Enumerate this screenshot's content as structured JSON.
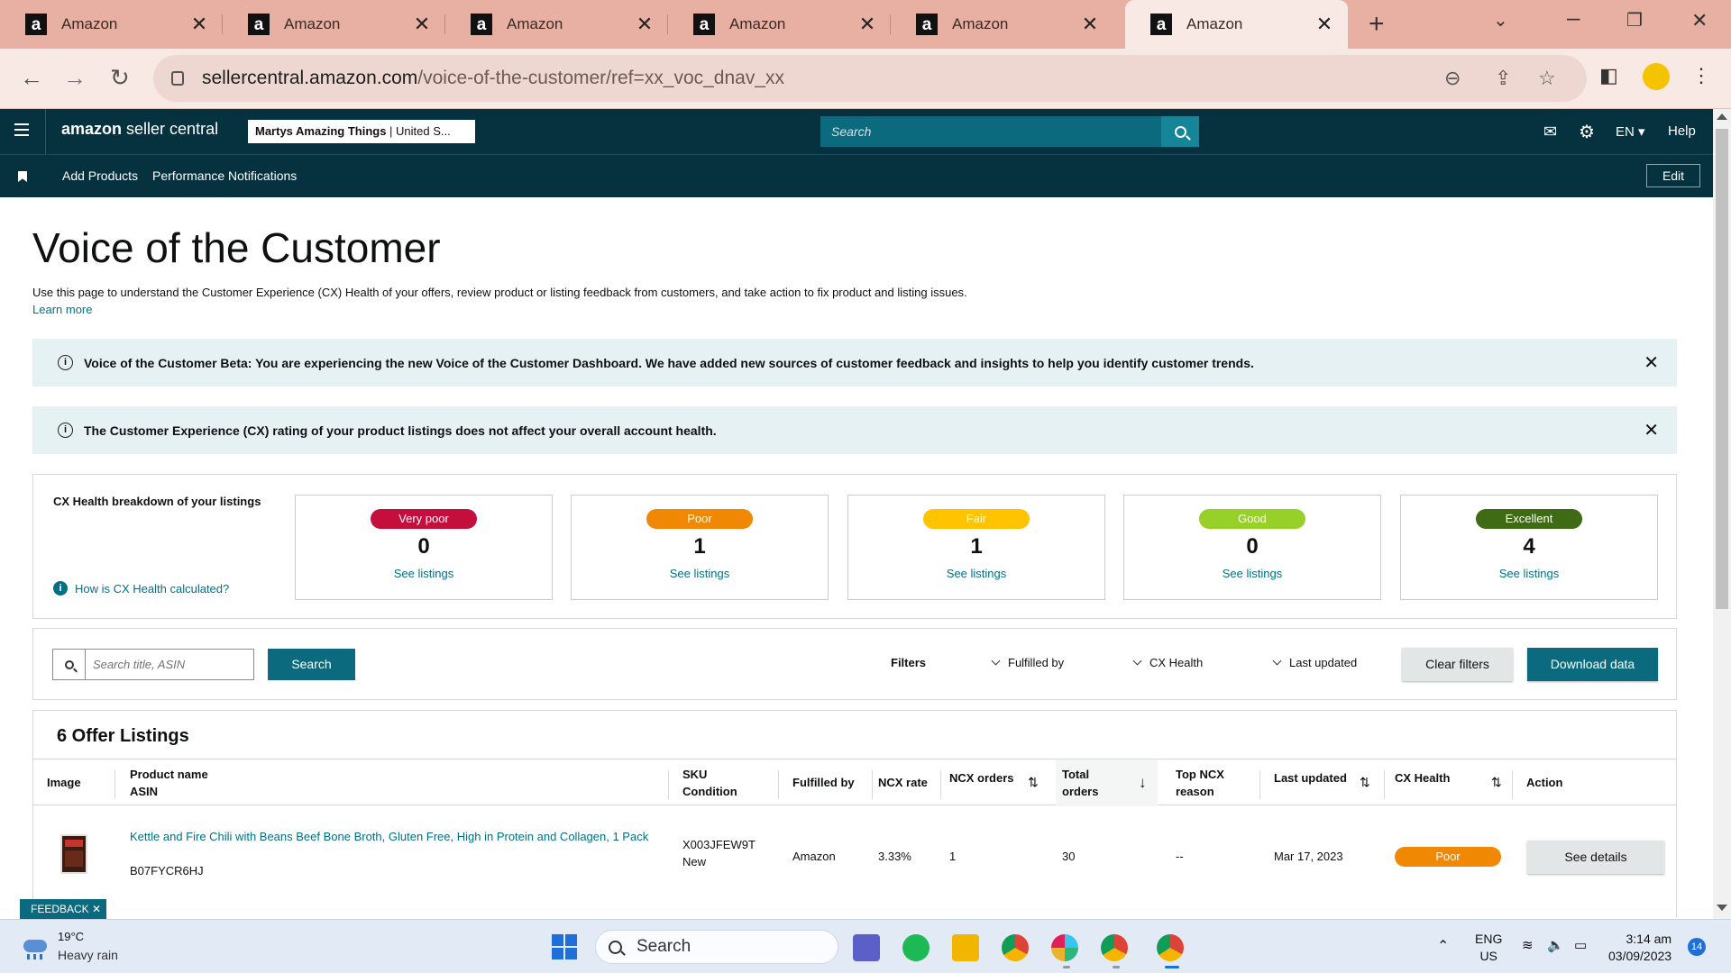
{
  "browser": {
    "tabs": [
      {
        "title": "Amazon"
      },
      {
        "title": "Amazon"
      },
      {
        "title": "Amazon"
      },
      {
        "title": "Amazon"
      },
      {
        "title": "Amazon"
      },
      {
        "title": "Amazon"
      }
    ],
    "favicon_letter": "a",
    "url_host": "sellercentral.amazon.com",
    "url_path": "/voice-of-the-customer/ref=xx_voc_dnav_xx"
  },
  "header": {
    "logo_bold": "amazon",
    "logo_rest": " seller central",
    "store_name": "Martys Amazing Things",
    "store_region": " | United S...",
    "search_placeholder": "Search",
    "language": "EN",
    "help": "Help"
  },
  "nav": {
    "links": [
      "Add Products",
      "Performance Notifications"
    ],
    "edit": "Edit"
  },
  "page": {
    "title": "Voice of the Customer",
    "description": "Use this page to understand the Customer Experience (CX) Health of your offers, review product or listing feedback from customers, and take action to fix product and listing issues.",
    "learn_more": "Learn more",
    "banners": [
      "Voice of the Customer Beta: You are experiencing the new Voice of the Customer Dashboard. We have added new sources of customer feedback and insights to help you identify customer trends.",
      "The Customer Experience (CX) rating of your product listings does not affect your overall account health."
    ]
  },
  "cx_health": {
    "title": "CX Health breakdown of your listings",
    "help_link": "How is CX Health calculated?",
    "see_label": "See listings",
    "cards": [
      {
        "label": "Very poor",
        "count": "0",
        "color": "#c40e3b"
      },
      {
        "label": "Poor",
        "count": "1",
        "color": "#f08804"
      },
      {
        "label": "Fair",
        "count": "1",
        "color": "#ffc300"
      },
      {
        "label": "Good",
        "count": "0",
        "color": "#98d02a"
      },
      {
        "label": "Excellent",
        "count": "4",
        "color": "#3e6b14"
      }
    ]
  },
  "filters": {
    "search_placeholder": "Search title, ASIN",
    "search_button": "Search",
    "label": "Filters",
    "dropdowns": [
      "Fulfilled by",
      "CX Health",
      "Last updated"
    ],
    "clear": "Clear filters",
    "download": "Download data"
  },
  "listings": {
    "title": "6 Offer Listings",
    "columns": {
      "image": "Image",
      "product_name": "Product name",
      "asin": "ASIN",
      "sku": "SKU",
      "condition": "Condition",
      "fulfilled_by": "Fulfilled by",
      "ncx_rate": "NCX rate",
      "ncx_orders": "NCX orders",
      "total_orders": "Total orders",
      "top_ncx_reason": "Top NCX reason",
      "last_updated": "Last updated",
      "cx_health": "CX Health",
      "action": "Action"
    },
    "rows": [
      {
        "product_name": "Kettle and Fire Chili with Beans Beef Bone Broth, Gluten Free, High in Protein and Collagen, 1 Pack",
        "asin": "B07FYCR6HJ",
        "sku": "X003JFEW9T",
        "condition": "New",
        "fulfilled_by": "Amazon",
        "ncx_rate": "3.33%",
        "ncx_orders": "1",
        "total_orders": "30",
        "top_ncx_reason": "--",
        "last_updated": "Mar 17, 2023",
        "cx_health": "Poor",
        "action": "See details"
      }
    ]
  },
  "feedback": "FEEDBACK ✕",
  "taskbar": {
    "temperature": "19°C",
    "weather": "Heavy rain",
    "search": "Search",
    "lang": "ENG",
    "region": "US",
    "time": "3:14 am",
    "date": "03/09/2023",
    "notifications": "14"
  }
}
